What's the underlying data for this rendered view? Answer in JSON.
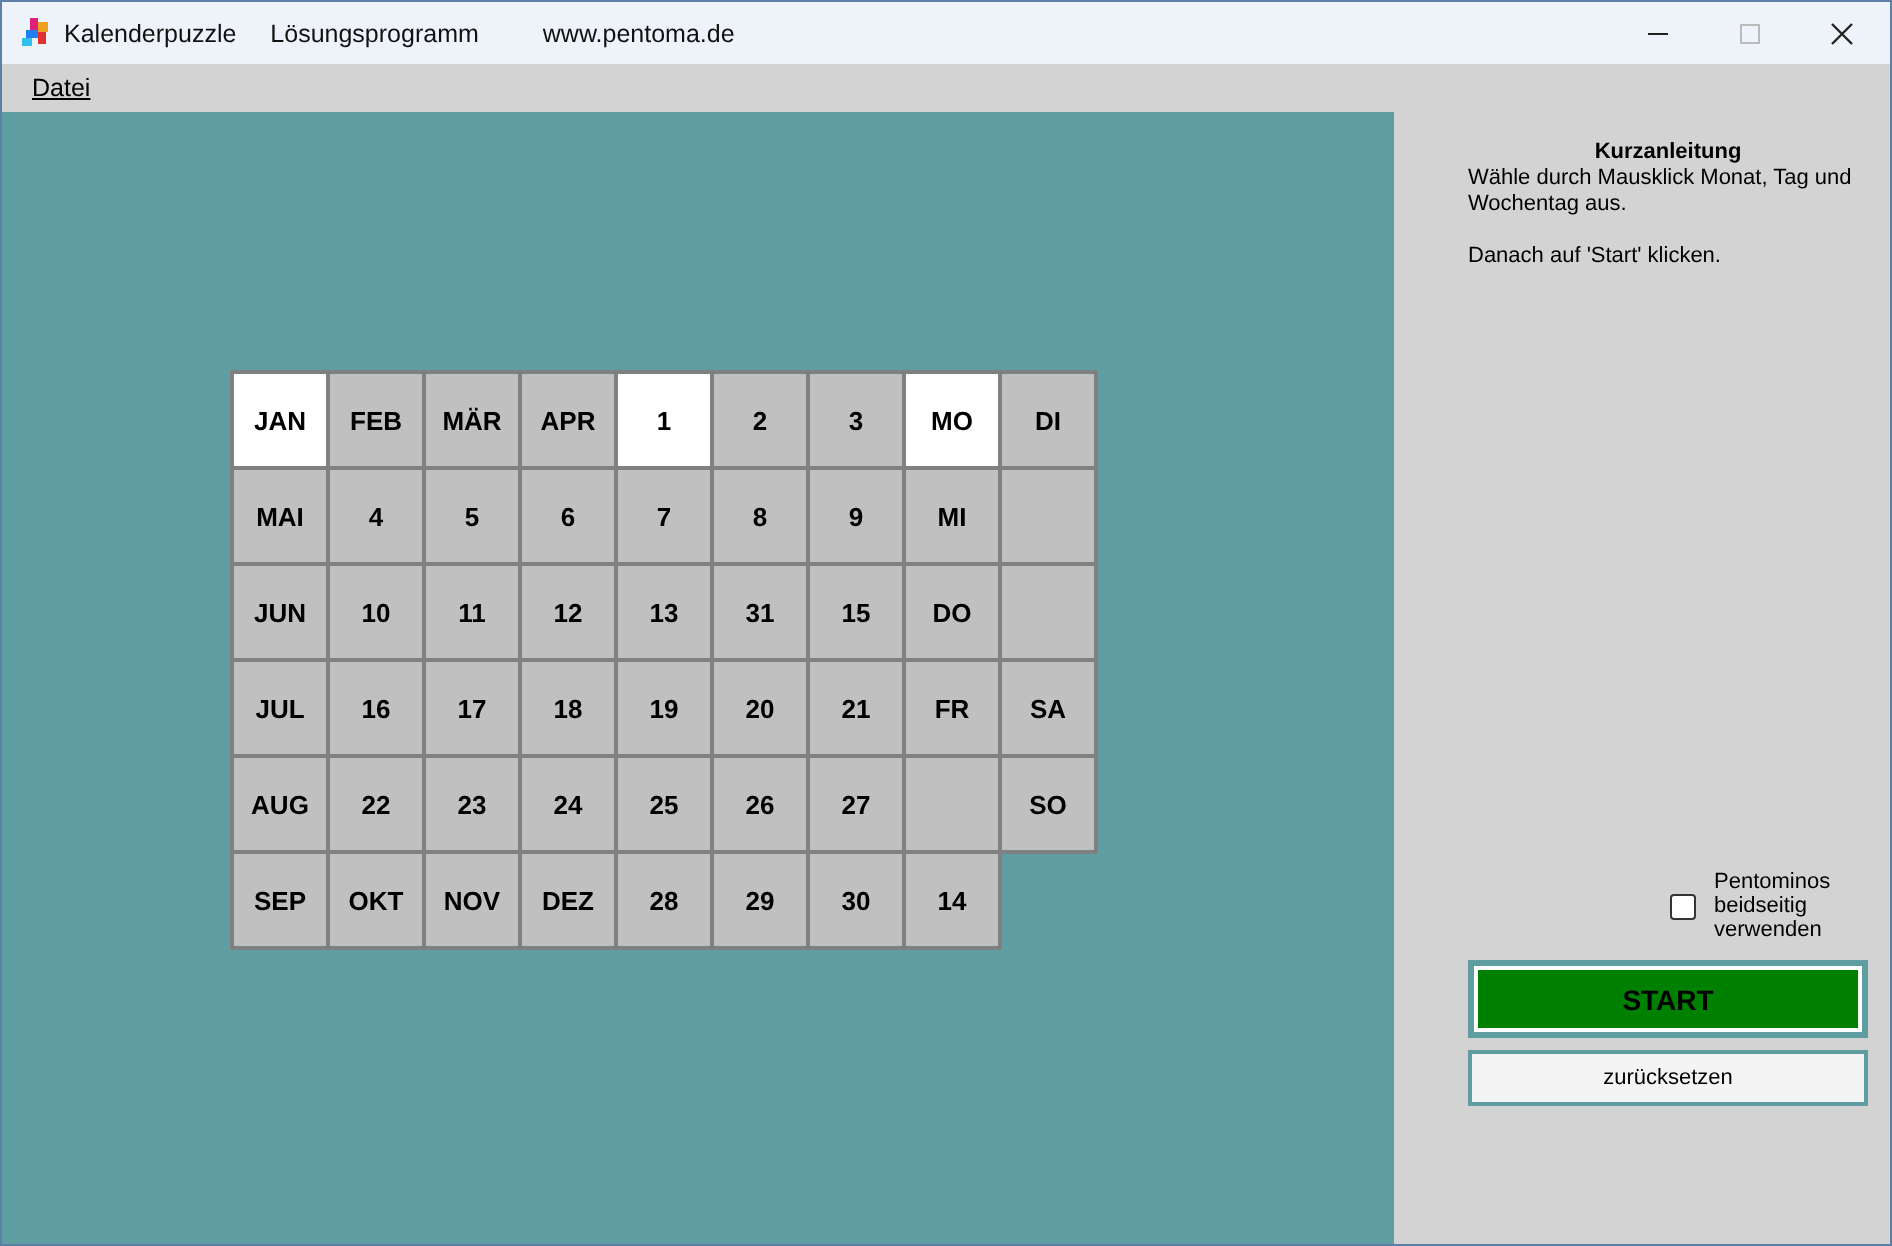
{
  "window": {
    "title": "Kalenderpuzzle",
    "title_items": [
      "Lösungsprogramm",
      "www.pentoma.de"
    ]
  },
  "menu": [
    "Datei"
  ],
  "board": {
    "rows": [
      [
        {
          "label": "JAN",
          "selected": true
        },
        {
          "label": "FEB",
          "selected": false
        },
        {
          "label": "MÄR",
          "selected": false
        },
        {
          "label": "APR",
          "selected": false
        },
        {
          "label": "1",
          "selected": true
        },
        {
          "label": "2",
          "selected": false
        },
        {
          "label": "3",
          "selected": false
        },
        {
          "label": "MO",
          "selected": true
        },
        {
          "label": "DI",
          "selected": false
        }
      ],
      [
        {
          "label": "MAI",
          "selected": false
        },
        {
          "label": "4",
          "selected": false
        },
        {
          "label": "5",
          "selected": false
        },
        {
          "label": "6",
          "selected": false
        },
        {
          "label": "7",
          "selected": false
        },
        {
          "label": "8",
          "selected": false
        },
        {
          "label": "9",
          "selected": false
        },
        {
          "label": "MI",
          "selected": false
        },
        {
          "selected": false
        }
      ],
      [
        {
          "label": "JUN",
          "selected": false
        },
        {
          "label": "10",
          "selected": false
        },
        {
          "label": "11",
          "selected": false
        },
        {
          "label": "12",
          "selected": false
        },
        {
          "label": "13",
          "selected": false
        },
        {
          "label": "31",
          "selected": false
        },
        {
          "label": "15",
          "selected": false
        },
        {
          "label": "DO",
          "selected": false
        },
        {
          "selected": false
        }
      ],
      [
        {
          "label": "JUL",
          "selected": false
        },
        {
          "label": "16",
          "selected": false
        },
        {
          "label": "17",
          "selected": false
        },
        {
          "label": "18",
          "selected": false
        },
        {
          "label": "19",
          "selected": false
        },
        {
          "label": "20",
          "selected": false
        },
        {
          "label": "21",
          "selected": false
        },
        {
          "label": "FR",
          "selected": false
        },
        {
          "label": "SA",
          "selected": false
        }
      ],
      [
        {
          "label": "AUG",
          "selected": false
        },
        {
          "label": "22",
          "selected": false
        },
        {
          "label": "23",
          "selected": false
        },
        {
          "label": "24",
          "selected": false
        },
        {
          "label": "25",
          "selected": false
        },
        {
          "label": "26",
          "selected": false
        },
        {
          "label": "27",
          "selected": false
        },
        {
          "selected": false
        },
        {
          "label": "SO",
          "selected": false
        }
      ],
      [
        {
          "label": "SEP",
          "selected": false
        },
        {
          "label": "OKT",
          "selected": false
        },
        {
          "label": "NOV",
          "selected": false
        },
        {
          "label": "DEZ",
          "selected": false
        },
        {
          "label": "28",
          "selected": false
        },
        {
          "label": "29",
          "selected": false
        },
        {
          "label": "30",
          "selected": false
        },
        {
          "label": "14",
          "selected": false
        }
      ]
    ]
  },
  "instructions": {
    "title": "Kurzanleitung",
    "paragraphs": [
      "Wähle durch Mausklick Monat, Tag und Wochentag aus.",
      "Danach auf 'Start' klicken."
    ]
  },
  "option": {
    "label": "Pentominos beidseitig verwenden",
    "checked": false
  },
  "buttons": [
    {
      "label": "START",
      "kind": "primary"
    },
    {
      "label": "zurücksetzen",
      "kind": "secondary"
    }
  ]
}
